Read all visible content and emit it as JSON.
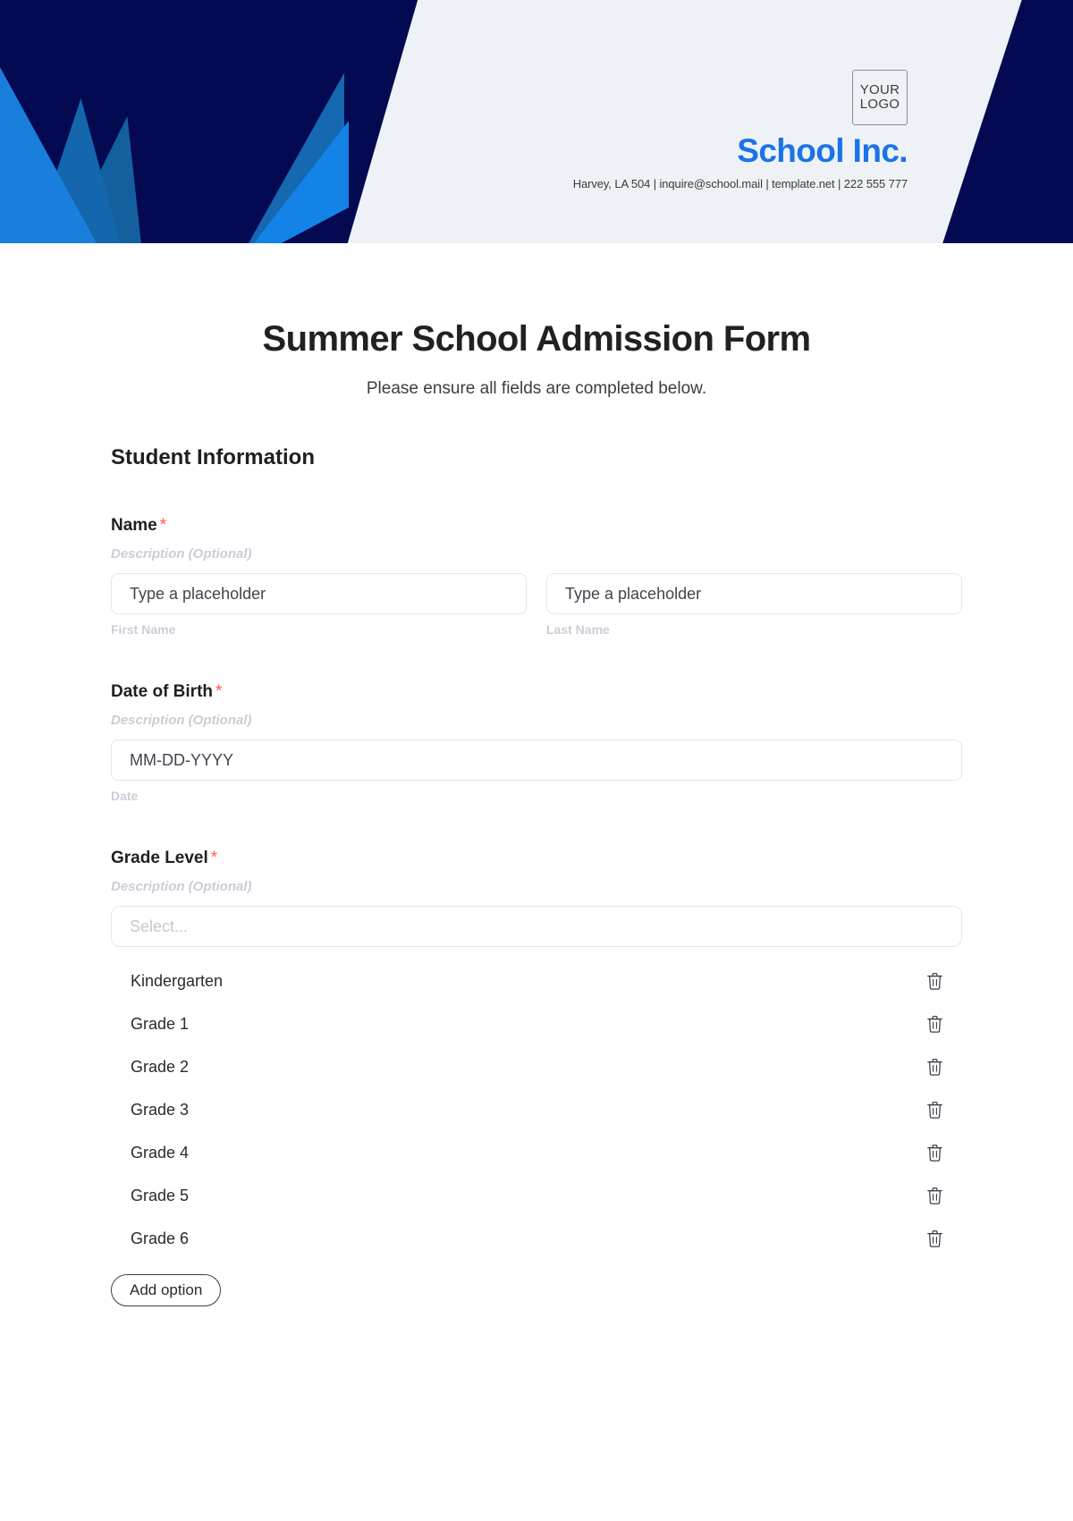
{
  "header": {
    "logo_line1": "YOUR",
    "logo_line2": "LOGO",
    "brand_name": "School Inc.",
    "contact": "Harvey, LA 504 | inquire@school.mail | template.net | 222 555 777",
    "colors": {
      "navy": "#030a52",
      "blue": "#1383e8",
      "panel": "#eef2f6",
      "brand_text": "#1a73e8"
    }
  },
  "document": {
    "title": "Summer School Admission Form",
    "subtitle": "Please ensure all fields are completed below.",
    "section_title": "Student Information"
  },
  "fields": {
    "name": {
      "label": "Name",
      "required_mark": "*",
      "description": "Description (Optional)",
      "first": {
        "placeholder": "Type a placeholder",
        "sub_label": "First Name"
      },
      "last": {
        "placeholder": "Type a placeholder",
        "sub_label": "Last Name"
      }
    },
    "dob": {
      "label": "Date of Birth",
      "required_mark": "*",
      "description": "Description (Optional)",
      "placeholder": "MM-DD-YYYY",
      "sub_label": "Date"
    },
    "grade": {
      "label": "Grade Level",
      "required_mark": "*",
      "description": "Description (Optional)",
      "select_placeholder": "Select...",
      "options": [
        "Kindergarten",
        "Grade 1",
        "Grade 2",
        "Grade 3",
        "Grade 4",
        "Grade 5",
        "Grade 6"
      ],
      "add_option_label": "Add option",
      "delete_icon": "trash-icon"
    }
  }
}
